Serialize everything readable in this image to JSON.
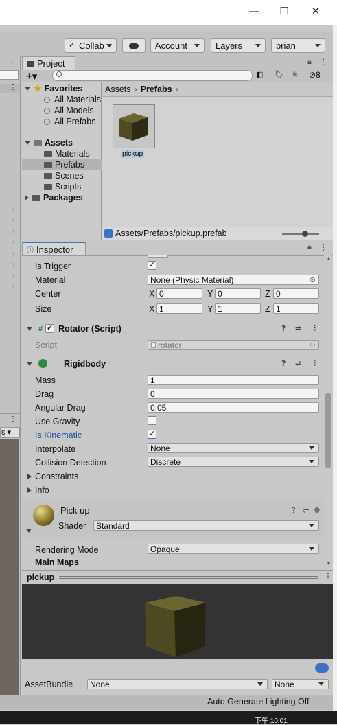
{
  "window": {
    "minimize": "—",
    "maximize": "☐",
    "close": "✕"
  },
  "toolbar": {
    "collab": "Collab",
    "account": "Account",
    "layers": "Layers",
    "layout": "brian"
  },
  "project": {
    "tab": "Project",
    "hidden_count": "8",
    "tree": {
      "favorites": "Favorites",
      "fav_items": [
        "All Materials",
        "All Models",
        "All Prefabs"
      ],
      "assets": "Assets",
      "asset_items": [
        "Materials",
        "Prefabs",
        "Scenes",
        "Scripts"
      ],
      "packages": "Packages"
    },
    "breadcrumb": [
      "Assets",
      "Prefabs"
    ],
    "asset_name": "pickup",
    "selected_path": "Assets/Prefabs/pickup.prefab"
  },
  "inspector": {
    "tab": "Inspector",
    "collider": {
      "is_trigger_label": "Is Trigger",
      "is_trigger": "✓",
      "material_label": "Material",
      "material": "None (Physic Material)",
      "center_label": "Center",
      "center": {
        "x": "0",
        "y": "0",
        "z": "0"
      },
      "size_label": "Size",
      "size": {
        "x": "1",
        "y": "1",
        "z": "1"
      },
      "x": "X",
      "y": "Y",
      "z": "Z"
    },
    "rotator": {
      "title": "Rotator (Script)",
      "script_label": "Script",
      "script": "rotator"
    },
    "rigidbody": {
      "title": "Rigidbody",
      "mass_label": "Mass",
      "mass": "1",
      "drag_label": "Drag",
      "drag": "0",
      "angular_drag_label": "Angular Drag",
      "angular_drag": "0.05",
      "use_gravity_label": "Use Gravity",
      "is_kinematic_label": "Is Kinematic",
      "is_kinematic": "✓",
      "interpolate_label": "Interpolate",
      "interpolate": "None",
      "collision_label": "Collision Detection",
      "collision": "Discrete",
      "constraints": "Constraints",
      "info": "Info"
    },
    "material": {
      "name": "Pick up",
      "shader_label": "Shader",
      "shader": "Standard",
      "rendering_mode_label": "Rendering Mode",
      "rendering_mode": "Opaque",
      "main_maps": "Main Maps"
    }
  },
  "preview": {
    "title": "pickup"
  },
  "assetbundle": {
    "label": "AssetBundle",
    "name": "None",
    "variant": "None"
  },
  "status": {
    "text": "Auto Generate Lighting Off"
  },
  "taskbar": {
    "time": "下午 10:01"
  },
  "colors": {
    "accent": "#3a72c4",
    "cube": "#5c5423",
    "link_blue": "#1f4fa8"
  }
}
